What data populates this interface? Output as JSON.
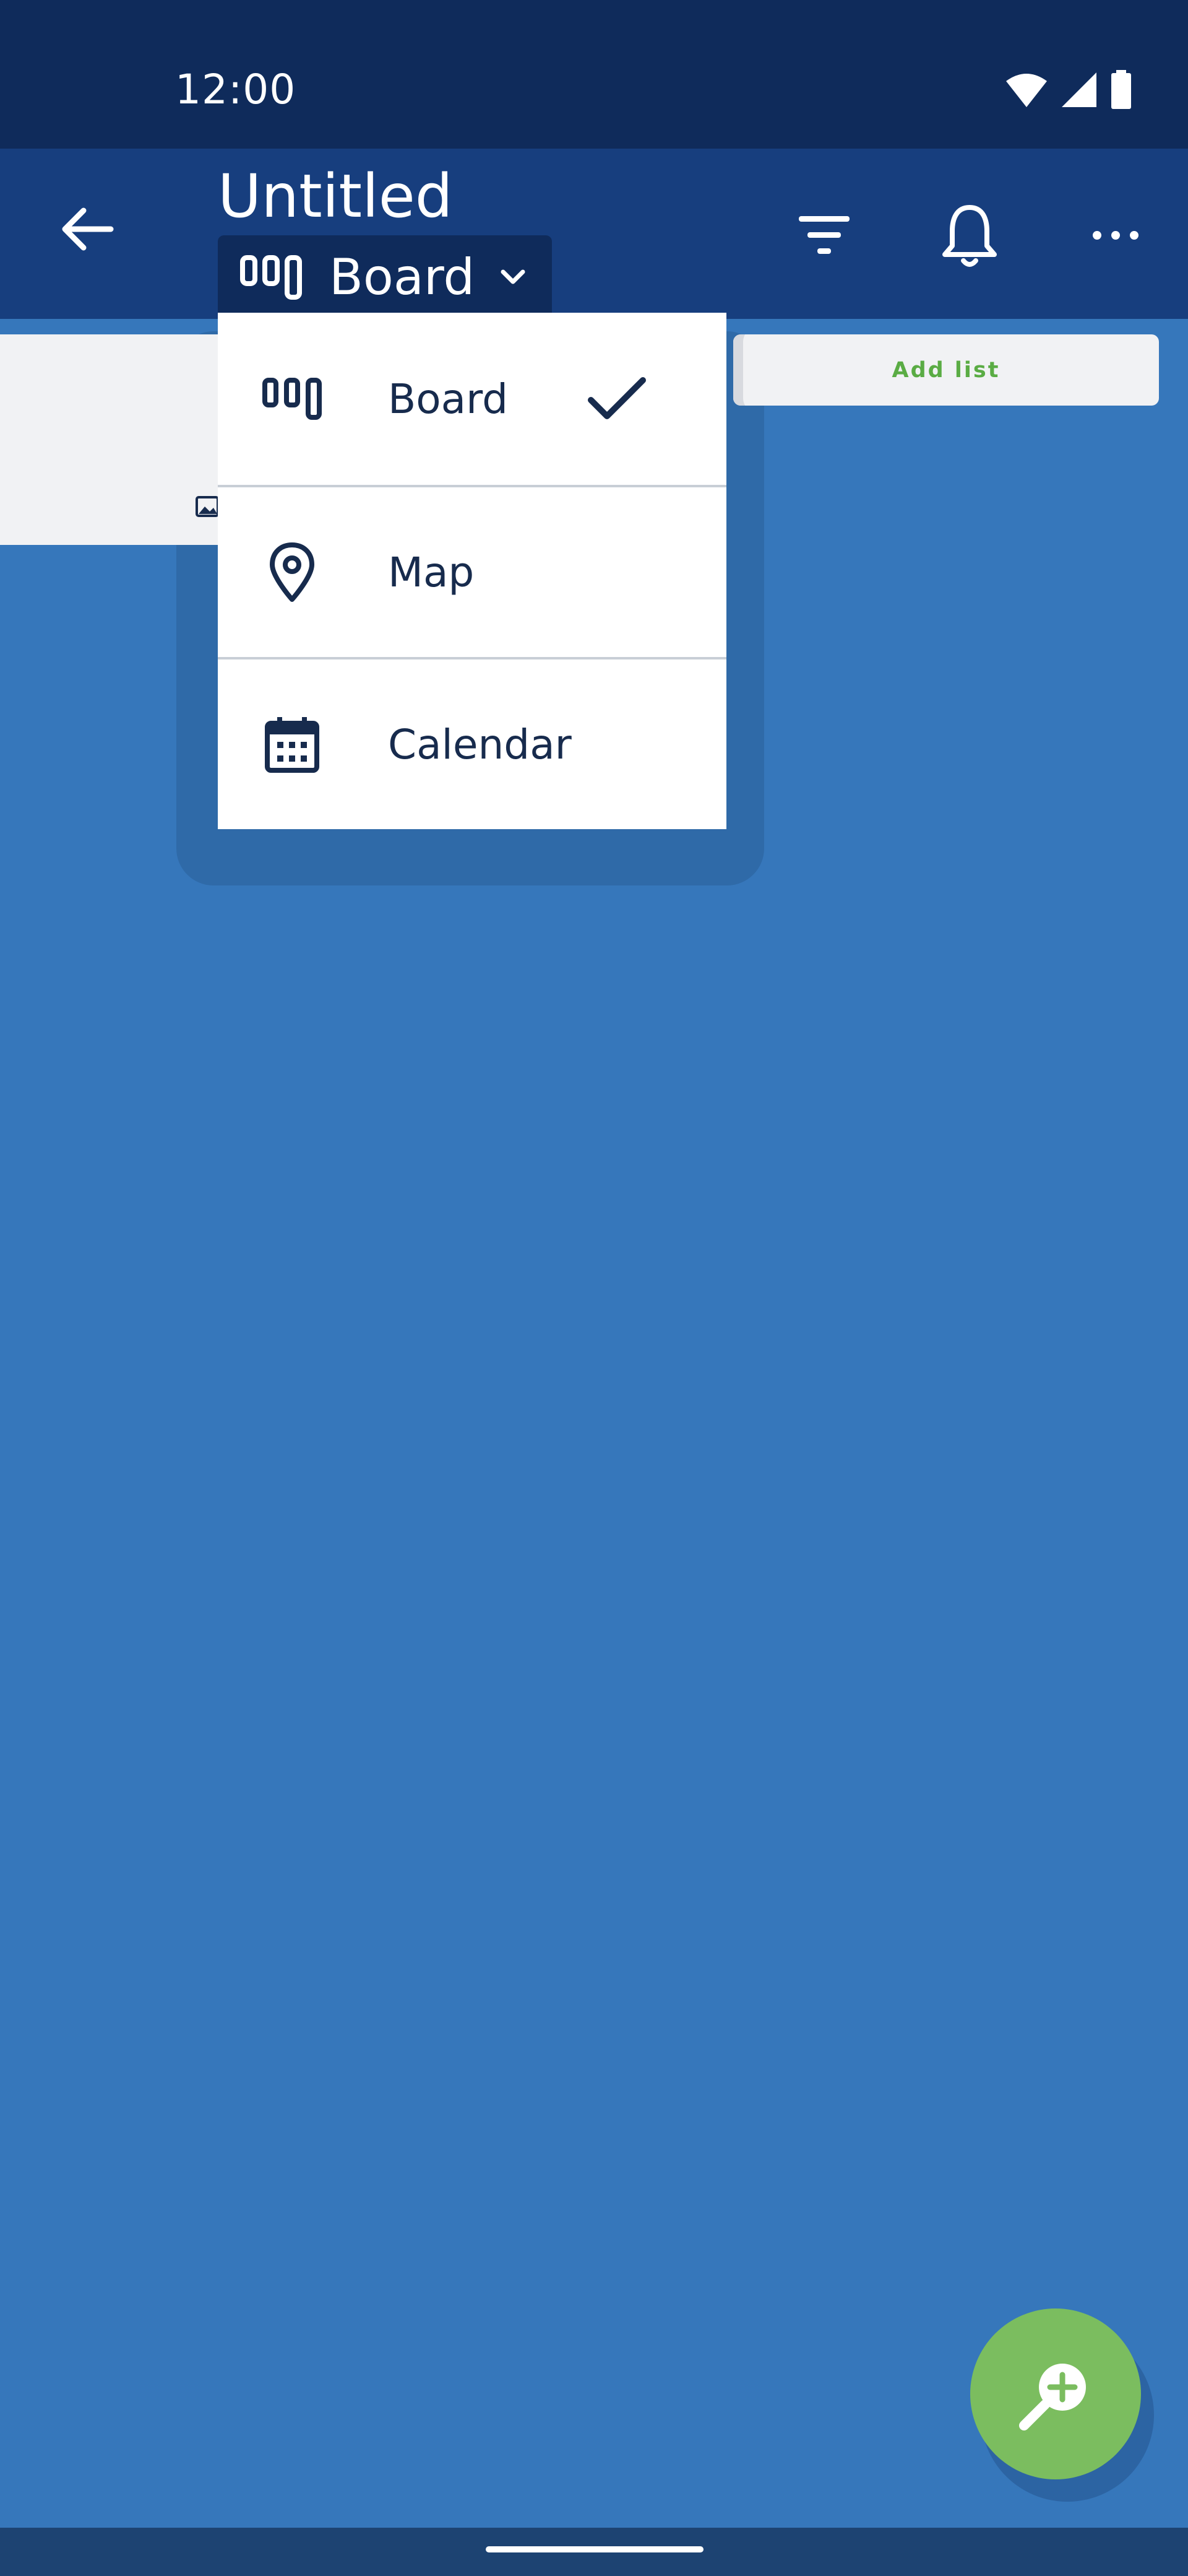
{
  "status_bar": {
    "time": "12:00",
    "icons": [
      "wifi-icon",
      "cellular-signal-icon",
      "battery-icon"
    ]
  },
  "app_bar": {
    "title": "Untitled",
    "current_view": "Board",
    "actions": [
      "back-arrow-icon",
      "filter-icon",
      "bell-icon",
      "more-icon"
    ]
  },
  "view_menu": {
    "items": [
      {
        "label": "Board",
        "icon": "board-icon",
        "selected": true
      },
      {
        "label": "Map",
        "icon": "map-pin-icon",
        "selected": false
      },
      {
        "label": "Calendar",
        "icon": "calendar-icon",
        "selected": false
      }
    ]
  },
  "board": {
    "add_list_label": "Add list"
  },
  "fab": {
    "icon": "zoom-in-icon"
  },
  "colors": {
    "status_bar": "#0f2b5b",
    "app_bar": "#173e7e",
    "background": "#3677bb",
    "fab": "#7bbd5f",
    "menu_text": "#172b4d",
    "add_list_text": "#5aac44"
  }
}
